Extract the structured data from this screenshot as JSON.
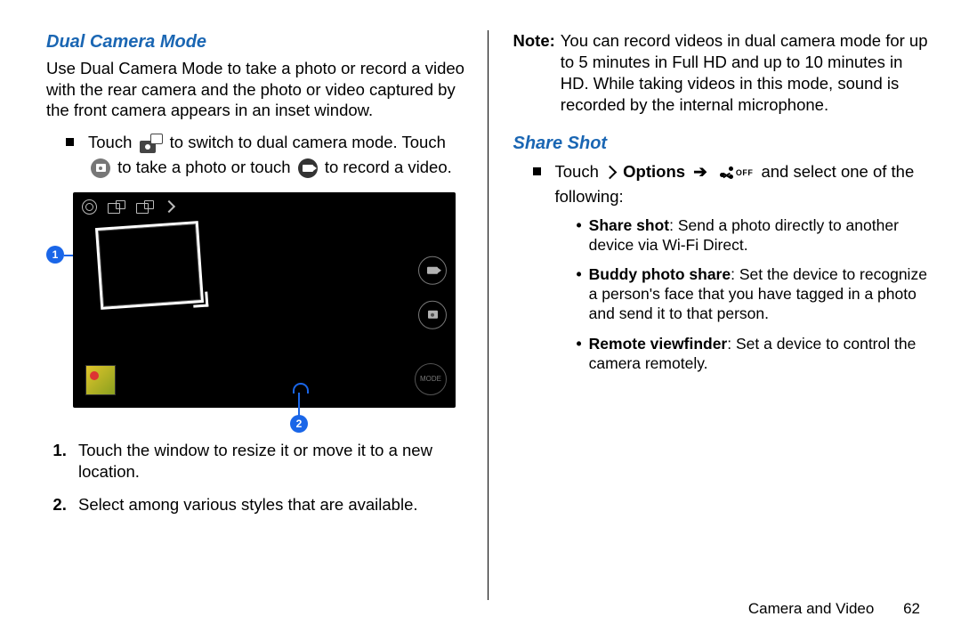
{
  "left": {
    "heading": "Dual Camera Mode",
    "intro": "Use Dual Camera Mode to take a photo or record a video with the rear camera and the photo or video captured by the front camera appears in an inset window.",
    "bullet_a": "Touch",
    "bullet_b": "to switch to dual camera mode. Touch",
    "bullet_c": "to take a photo or touch",
    "bullet_d": "to record a video.",
    "step1": "Touch the window to resize it or move it to a new location.",
    "step2": "Select among various styles that are available.",
    "callout1": "1",
    "callout2": "2",
    "mode_label": "MODE"
  },
  "right": {
    "note_label": "Note:",
    "note_body": "You can record videos in dual camera mode for up to 5 minutes in Full HD and up to 10 minutes in HD. While taking videos in this mode, sound is recorded by the internal microphone.",
    "heading": "Share Shot",
    "line_a": "Touch",
    "options_label": "Options",
    "arrow": "➔",
    "off_label": "OFF",
    "line_b": "and select one of the following:",
    "items": [
      {
        "lead": "Share shot",
        "rest": ": Send a photo directly to another device via Wi-Fi Direct."
      },
      {
        "lead": "Buddy photo share",
        "rest": ": Set the device to recognize a person's face that you have tagged in a photo and send it to that person."
      },
      {
        "lead": "Remote viewfinder",
        "rest": ": Set a device to control the camera remotely."
      }
    ]
  },
  "footer": {
    "section": "Camera and Video",
    "page": "62"
  }
}
